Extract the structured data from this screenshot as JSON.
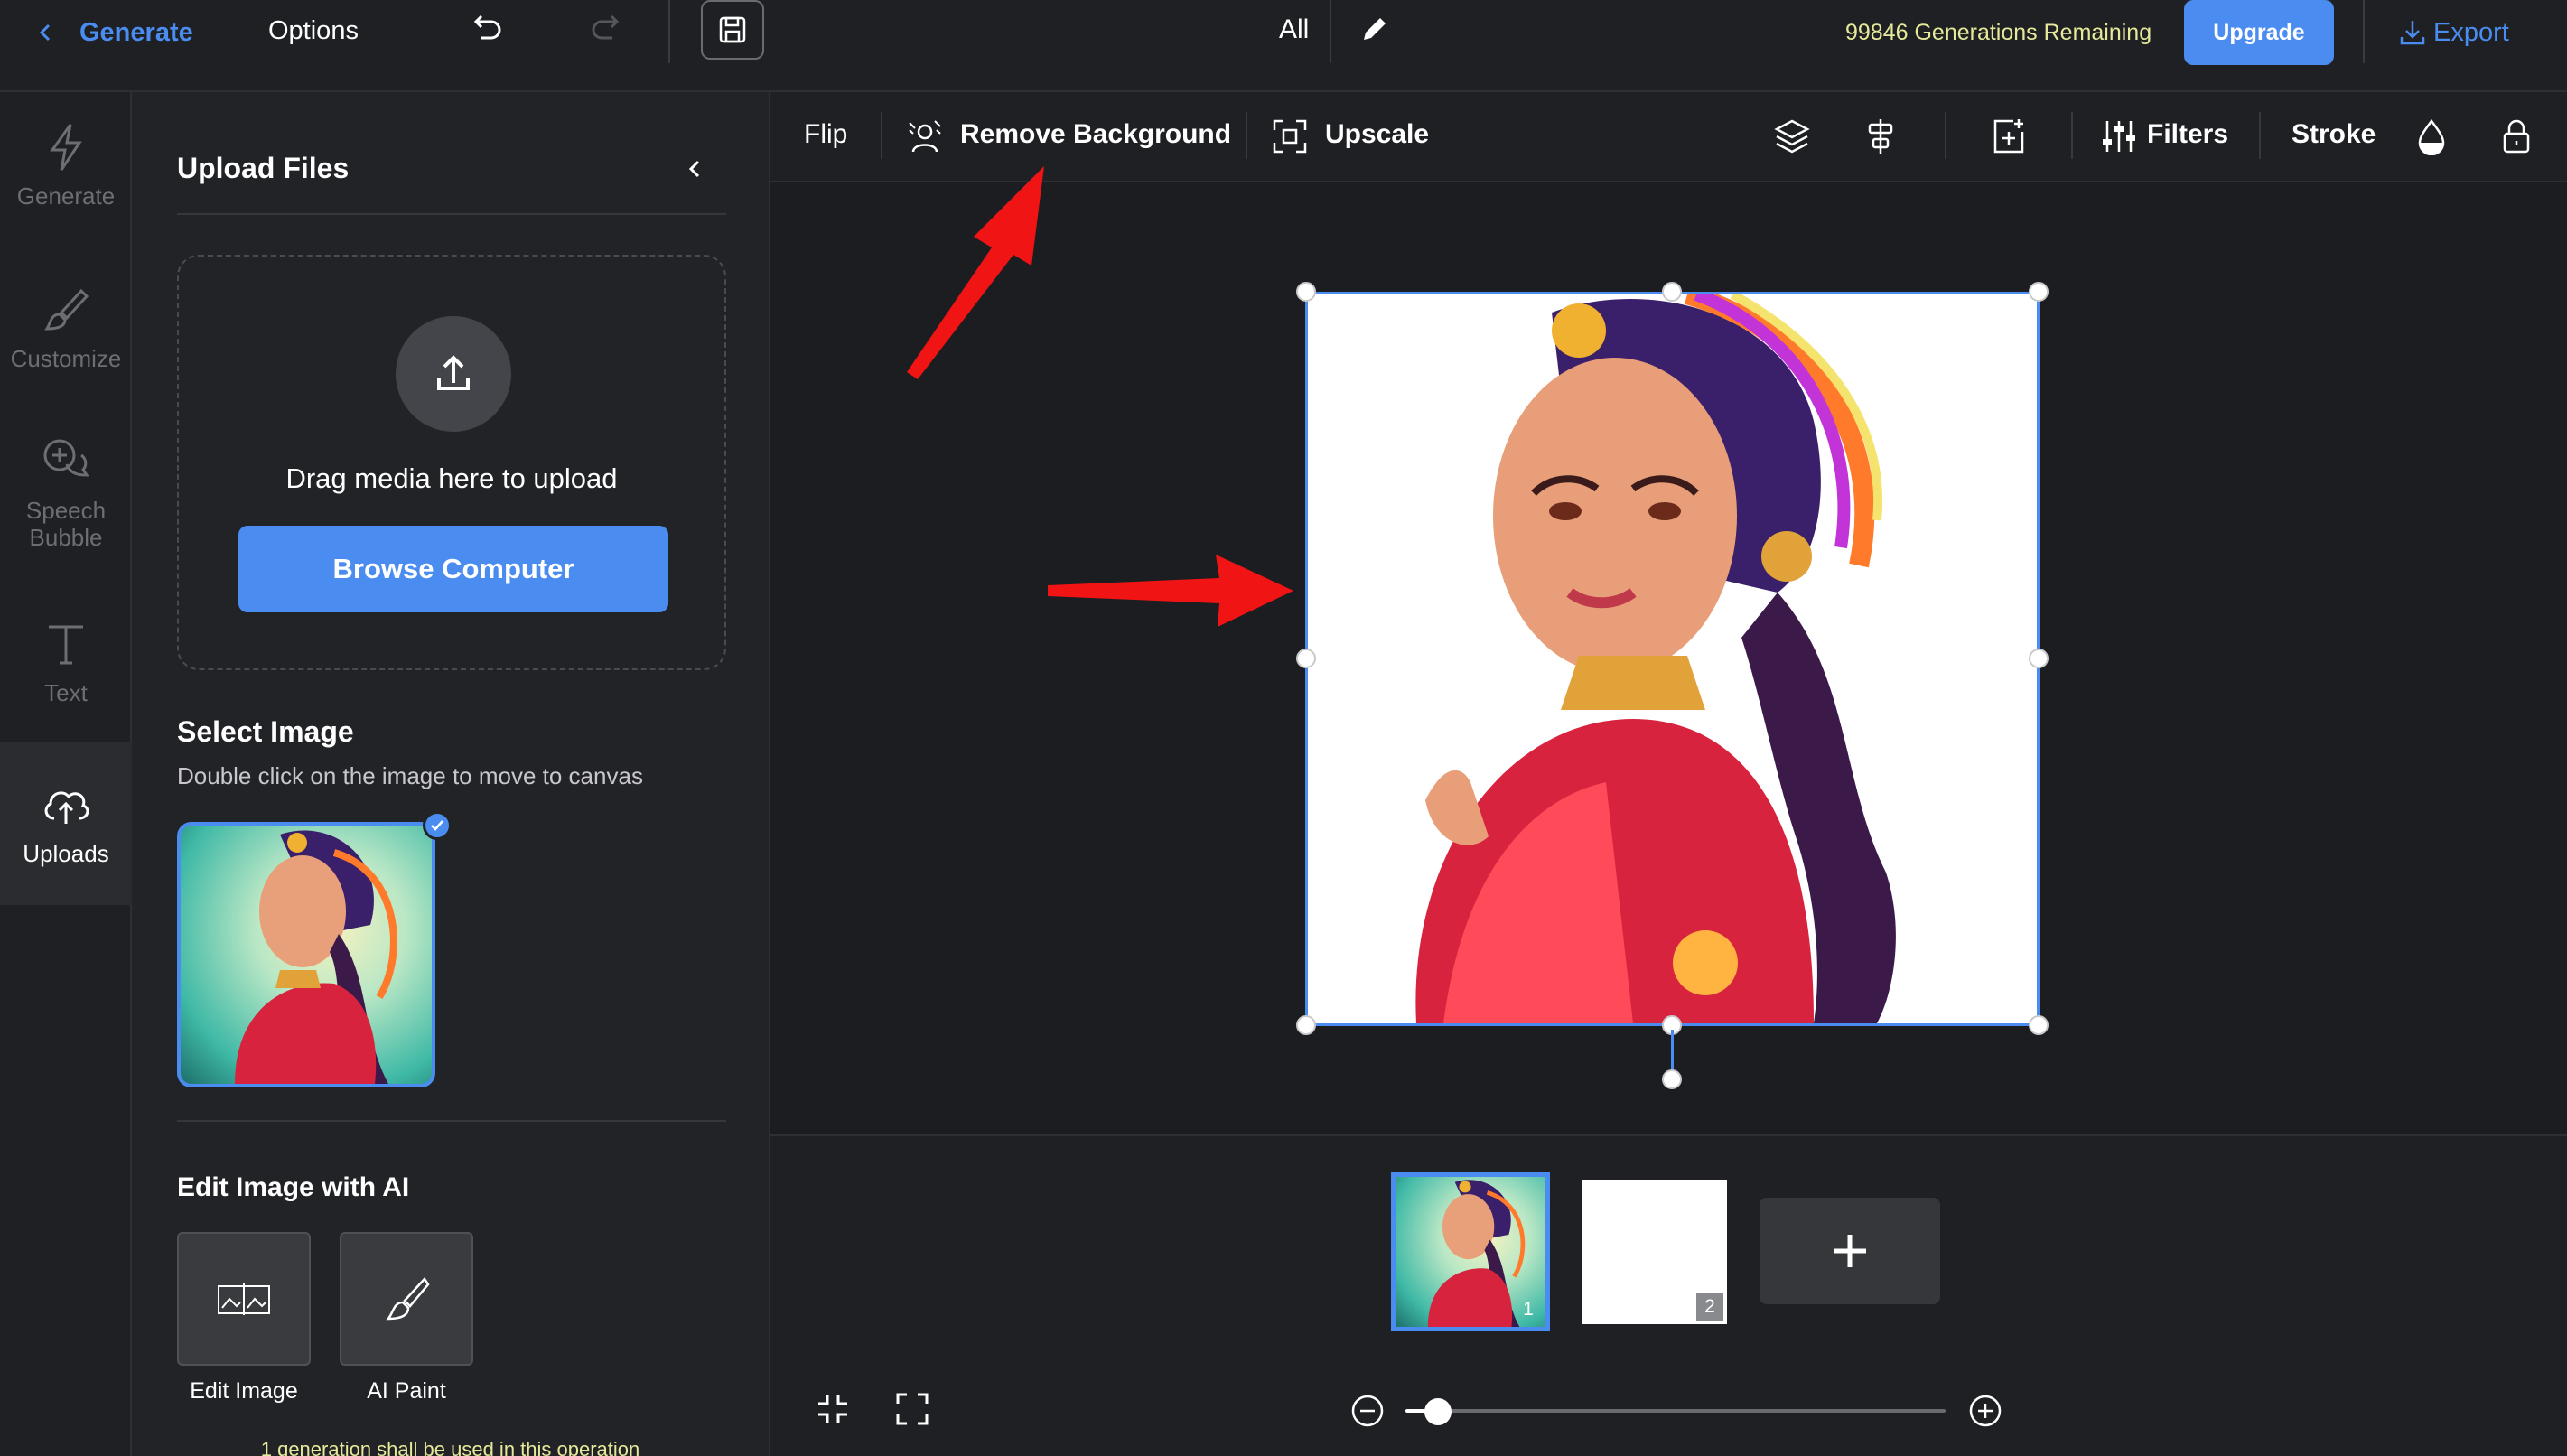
{
  "topbar": {
    "back_label": "Generate",
    "options_label": "Options",
    "filter_label": "All",
    "generations_remaining": "99846 Generations Remaining",
    "upgrade_label": "Upgrade",
    "export_label": "Export"
  },
  "rail": {
    "items": [
      {
        "label": "Generate",
        "icon": "lightning-icon"
      },
      {
        "label": "Customize",
        "icon": "brush-icon"
      },
      {
        "label": "Speech Bubble",
        "icon": "speech-bubble-icon"
      },
      {
        "label": "Text",
        "icon": "text-icon"
      },
      {
        "label": "Uploads",
        "icon": "cloud-upload-icon",
        "active": true
      }
    ]
  },
  "panel": {
    "title": "Upload Files",
    "drag_text": "Drag media here to upload",
    "browse_label": "Browse Computer",
    "select_title": "Select Image",
    "select_subtitle": "Double click on the image to move to canvas",
    "edit_title": "Edit Image with AI",
    "tools": [
      {
        "label": "Edit Image",
        "icon": "edit-image-icon"
      },
      {
        "label": "AI Paint",
        "icon": "paintbrush-icon"
      }
    ],
    "note": "1 generation shall be used in this operation"
  },
  "toolbar": {
    "flip_label": "Flip",
    "remove_bg_label": "Remove Background",
    "upscale_label": "Upscale",
    "filters_label": "Filters",
    "stroke_label": "Stroke"
  },
  "pages": {
    "items": [
      {
        "number": "1",
        "selected": true
      },
      {
        "number": "2",
        "selected": false
      }
    ]
  },
  "zoom": {
    "level": 0.06
  },
  "colors": {
    "accent": "#4a8cf0",
    "background": "#1c1d20",
    "annotation_arrow": "#f01414",
    "remaining_text": "#e7e99a"
  }
}
